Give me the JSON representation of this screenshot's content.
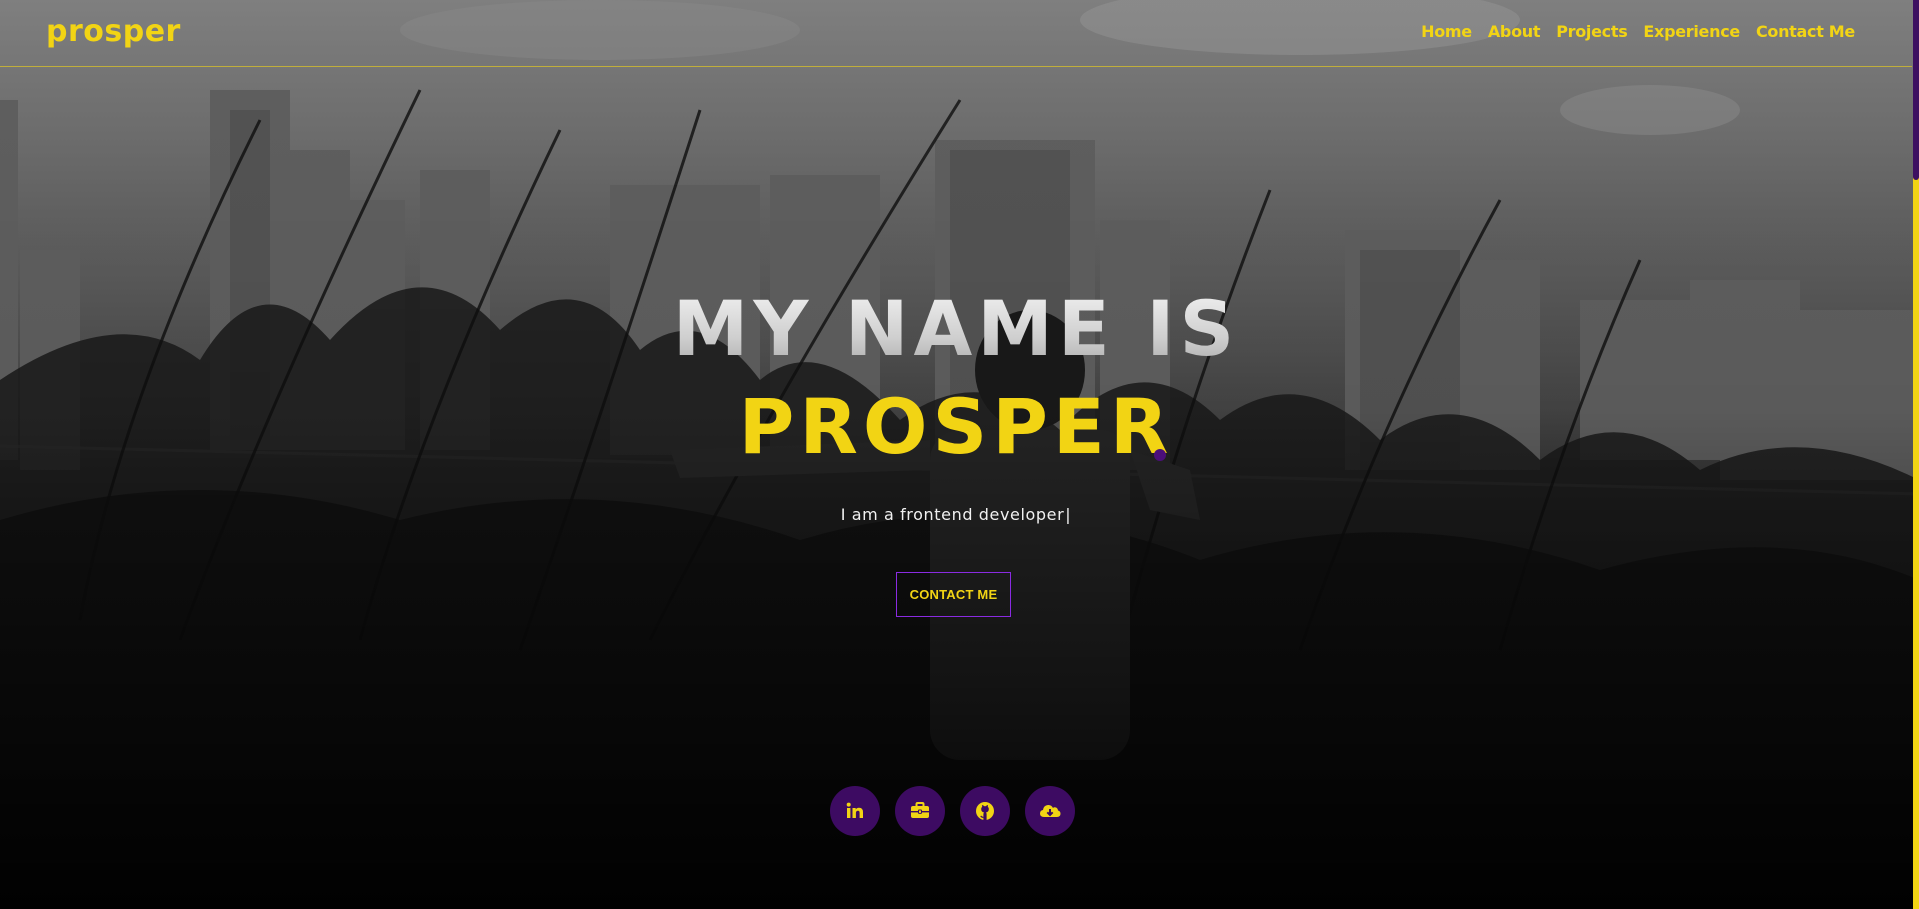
{
  "brand": {
    "logo": "prosper",
    "accent_color": "#f2d414",
    "secondary_color": "#3d0b62"
  },
  "nav": {
    "items": [
      {
        "label": "Home"
      },
      {
        "label": "About"
      },
      {
        "label": "Projects"
      },
      {
        "label": "Experience"
      },
      {
        "label": "Contact Me"
      }
    ]
  },
  "hero": {
    "line1": "MY NAME IS",
    "line2": "PROSPER",
    "subtitle": "I am a frontend developer",
    "cursor": "|",
    "contact_button": "CONTACT ME"
  },
  "socials": [
    {
      "icon": "linkedin-icon"
    },
    {
      "icon": "briefcase-icon"
    },
    {
      "icon": "github-icon"
    },
    {
      "icon": "download-cloud-icon"
    }
  ]
}
